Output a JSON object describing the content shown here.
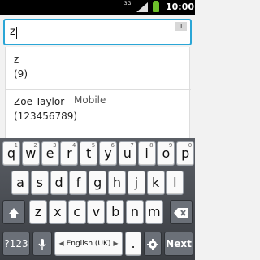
{
  "status": {
    "network": "3G",
    "time": "10:00"
  },
  "search": {
    "value": "z",
    "count_badge": "1"
  },
  "suggestions": [
    {
      "line1": "z",
      "line2": "(9)",
      "type": ""
    },
    {
      "line1": "Zoe Taylor",
      "line2": "(123456789)",
      "type": "Mobile"
    }
  ],
  "keyboard": {
    "row1": [
      {
        "k": "q",
        "alt": "1"
      },
      {
        "k": "w",
        "alt": "2"
      },
      {
        "k": "e",
        "alt": "3"
      },
      {
        "k": "r",
        "alt": "4"
      },
      {
        "k": "t",
        "alt": "5"
      },
      {
        "k": "y",
        "alt": "6"
      },
      {
        "k": "u",
        "alt": "7"
      },
      {
        "k": "i",
        "alt": "8"
      },
      {
        "k": "o",
        "alt": "9"
      },
      {
        "k": "p",
        "alt": "0"
      }
    ],
    "row2": [
      "a",
      "s",
      "d",
      "f",
      "g",
      "h",
      "j",
      "k",
      "l"
    ],
    "row3": [
      "z",
      "x",
      "c",
      "v",
      "b",
      "n",
      "m"
    ],
    "symbols": "?123",
    "language": "English (UK)",
    "period": ".",
    "next": "Next"
  }
}
